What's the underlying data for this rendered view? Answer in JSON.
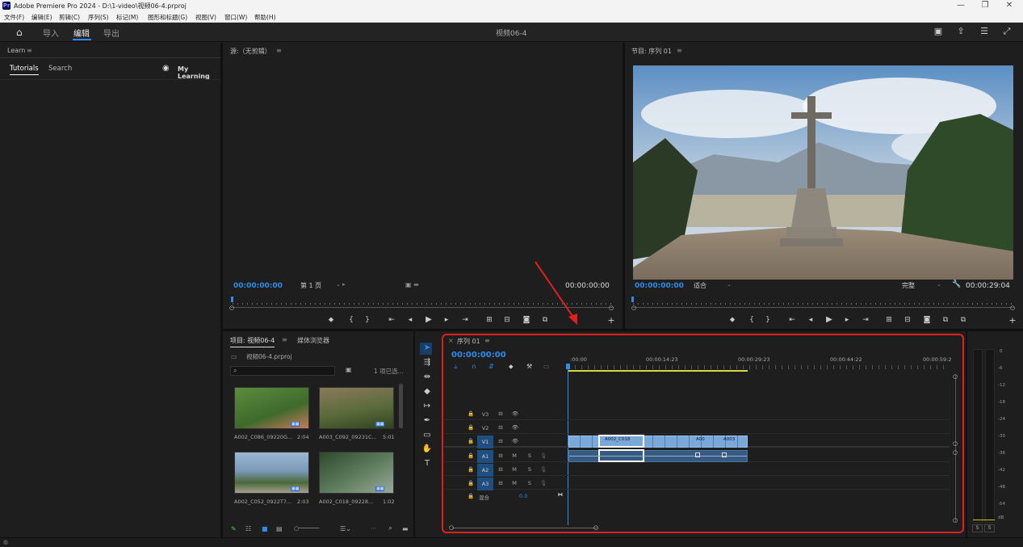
{
  "app": {
    "title": "Adobe Premiere Pro 2024 - D:\\1-video\\视频06-4.prproj",
    "logo": "Pr"
  },
  "menu": [
    "文件(F)",
    "编辑(E)",
    "剪辑(C)",
    "序列(S)",
    "标记(M)",
    "图形和标题(G)",
    "视图(V)",
    "窗口(W)",
    "帮助(H)"
  ],
  "workspace": {
    "tabs": [
      "导入",
      "编辑",
      "导出"
    ],
    "active": "编辑",
    "center_title": "视频06-4"
  },
  "learn": {
    "header": "Learn",
    "tabs": [
      "Tutorials",
      "Search"
    ],
    "my_learning": "My Learning"
  },
  "source": {
    "header": "源:（无剪辑）",
    "tc_left": "00:00:00:00",
    "page": "第 1 页",
    "tc_right": "00:00:00:00"
  },
  "program": {
    "header": "节目: 序列 01",
    "tc_left": "00:00:00:00",
    "fit": "适合",
    "quality": "完整",
    "tc_right": "00:00:29:04"
  },
  "project": {
    "tabs": [
      "项目: 视频06-4",
      "媒体浏览器"
    ],
    "file": "视频06-4.prproj",
    "search_placeholder": "",
    "count": "1 项已选...",
    "items": [
      {
        "name": "A002_C086_09220G...",
        "dur": "2:04",
        "colors": [
          "#4f7a3a",
          "#c98a6e"
        ]
      },
      {
        "name": "A003_C092_09231C...",
        "dur": "5:01",
        "colors": [
          "#5a6b3a",
          "#8a7a5a"
        ]
      },
      {
        "name": "A002_C052_0922T7...",
        "dur": "2:03",
        "colors": [
          "#7a9ab8",
          "#4a6a3a"
        ]
      },
      {
        "name": "A002_C018_09228...",
        "dur": "1:02",
        "colors": [
          "#3a5a3a",
          "#8a9a8a"
        ]
      }
    ]
  },
  "timeline": {
    "tab": "序列 01",
    "tc": "00:00:00:00",
    "ruler": [
      ":00:00",
      "00:00:14:23",
      "00:00:29:23",
      "00:00:44:22",
      "00:00:59:2"
    ],
    "video_tracks": [
      "V3",
      "V2",
      "V1"
    ],
    "audio_tracks": [
      "A1",
      "A2",
      "A3"
    ],
    "mix_label": "混合",
    "mix_value": "0.0",
    "clips": [
      "A002_C018",
      "A00",
      "A003"
    ]
  },
  "meter": {
    "scale": [
      "0",
      "-6",
      "-12",
      "-18",
      "-24",
      "-30",
      "-36",
      "-42",
      "-48",
      "-54",
      "dB"
    ],
    "solo": [
      "S",
      "S"
    ]
  },
  "colors": {
    "accent": "#2d8ceb",
    "highlight": "#e02020"
  }
}
